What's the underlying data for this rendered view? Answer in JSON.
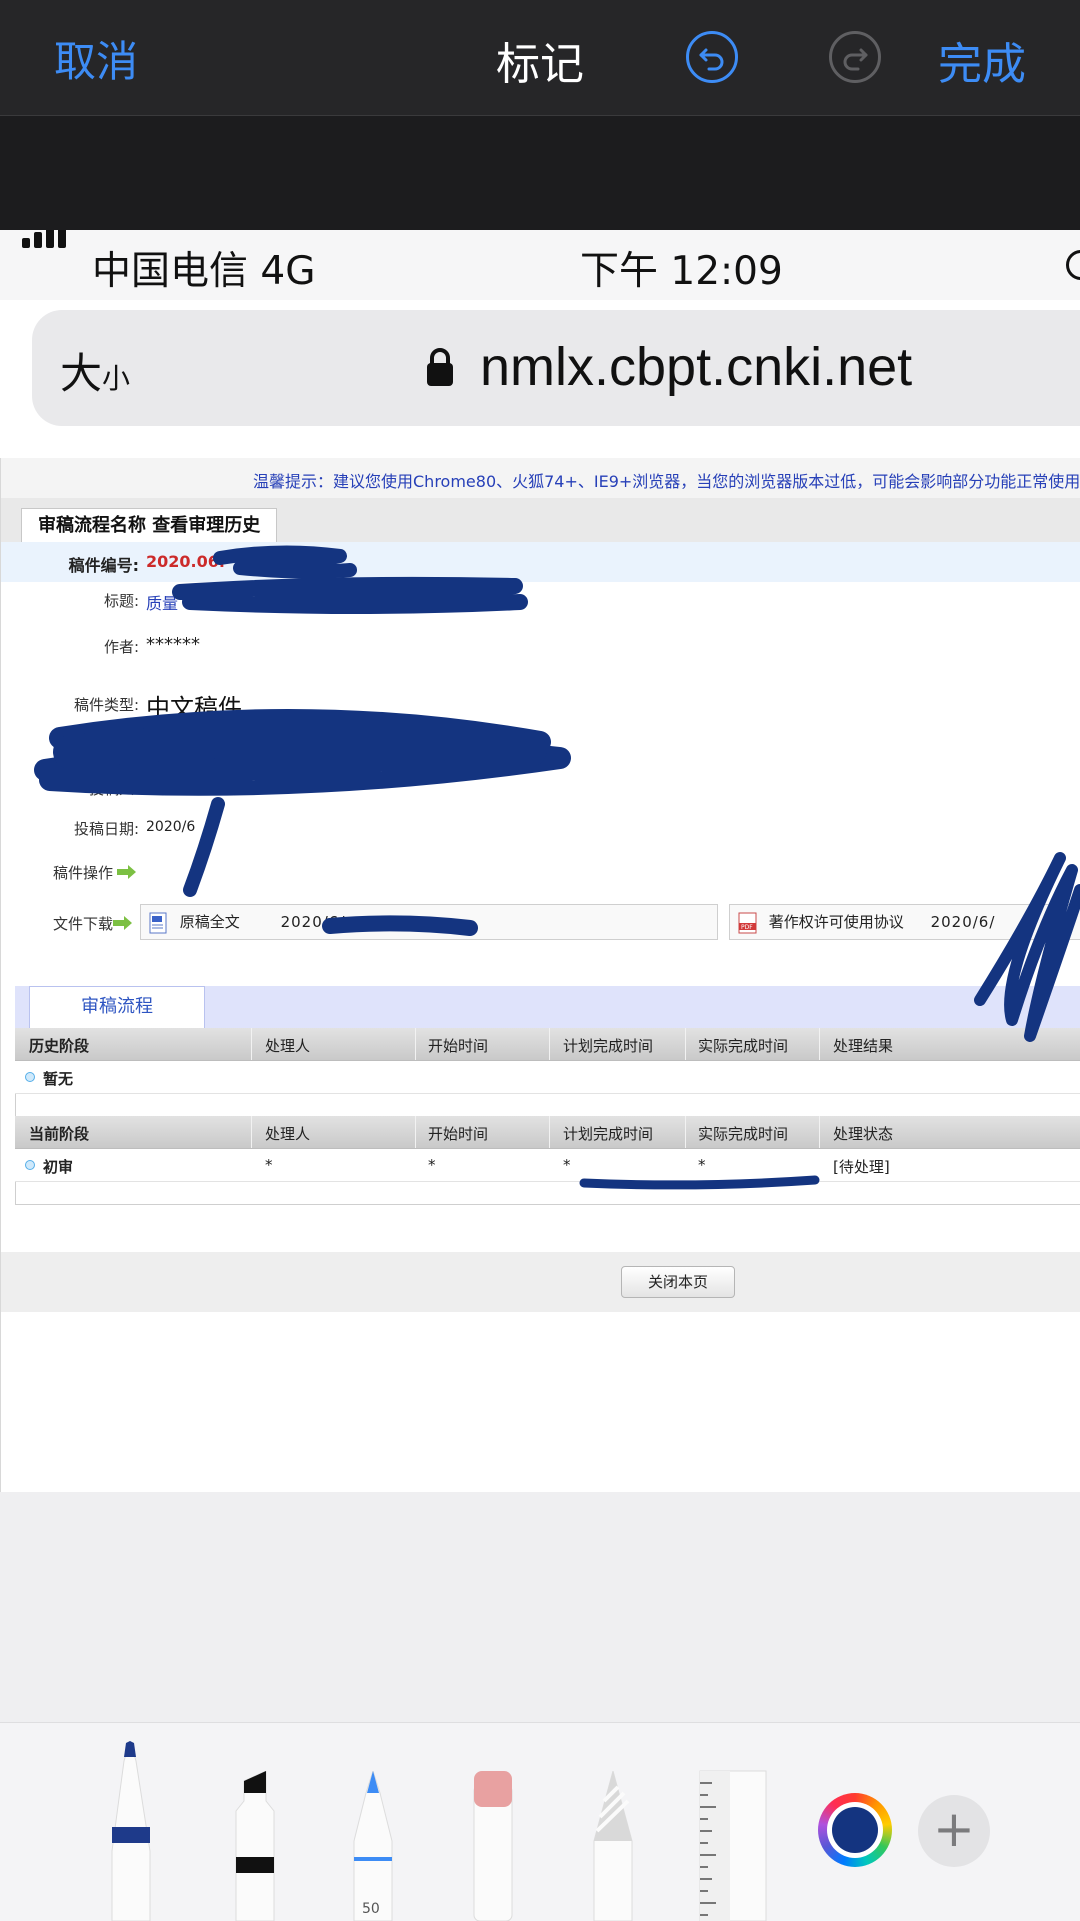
{
  "markup_bar": {
    "cancel": "取消",
    "title": "标记",
    "done": "完成",
    "undo_icon": "undo-icon",
    "redo_icon": "redo-icon"
  },
  "status_bar": {
    "carrier": "中国电信  4G",
    "time": "下午 12:09"
  },
  "address_bar": {
    "text_size": "大",
    "text_size_small": "小",
    "url": "nmlx.cbpt.cnki.net"
  },
  "page": {
    "tip": "温馨提示：建议您使用Chrome80、火狐74+、IE9+浏览器，当您的浏览器版本过低，可能会影响部分功能正常使用",
    "tab_title": "审稿流程名称 查看审理历史",
    "fields": {
      "code_label": "稿件编号:",
      "code_value": "2020.06.",
      "title_label": "标题:",
      "title_value": "质量",
      "author_label": "作者:",
      "author_value": "******",
      "type_label": "稿件类型:",
      "type_value": "中文稿件",
      "submitter_label": "投稿人:",
      "date_label": "投稿日期:",
      "date_value": "2020/6",
      "ops_label": "稿件操作",
      "download_label": "文件下载"
    },
    "downloads": [
      {
        "name": "原稿全文",
        "date": "2020/6/"
      },
      {
        "name": "著作权许可使用协议",
        "date": "2020/6/"
      }
    ],
    "flow_tab": "审稿流程",
    "history_table": {
      "headers": [
        "历史阶段",
        "处理人",
        "开始时间",
        "计划完成时间",
        "实际完成时间",
        "处理结果"
      ],
      "rows": [
        [
          "暂无",
          "",
          "",
          "",
          "",
          ""
        ]
      ]
    },
    "current_table": {
      "headers": [
        "当前阶段",
        "处理人",
        "开始时间",
        "计划完成时间",
        "实际完成时间",
        "处理状态"
      ],
      "rows": [
        [
          "初审",
          "*",
          "*",
          "*",
          "*",
          "[待处理]"
        ]
      ]
    },
    "close_button": "关闭本页"
  },
  "toolbar": {
    "pen_size": "50",
    "tools": [
      "pen-tool",
      "marker-tool",
      "pencil-tool",
      "eraser-tool",
      "lasso-tool",
      "ruler-tool"
    ],
    "selected_color": "#143480",
    "add": "+"
  }
}
